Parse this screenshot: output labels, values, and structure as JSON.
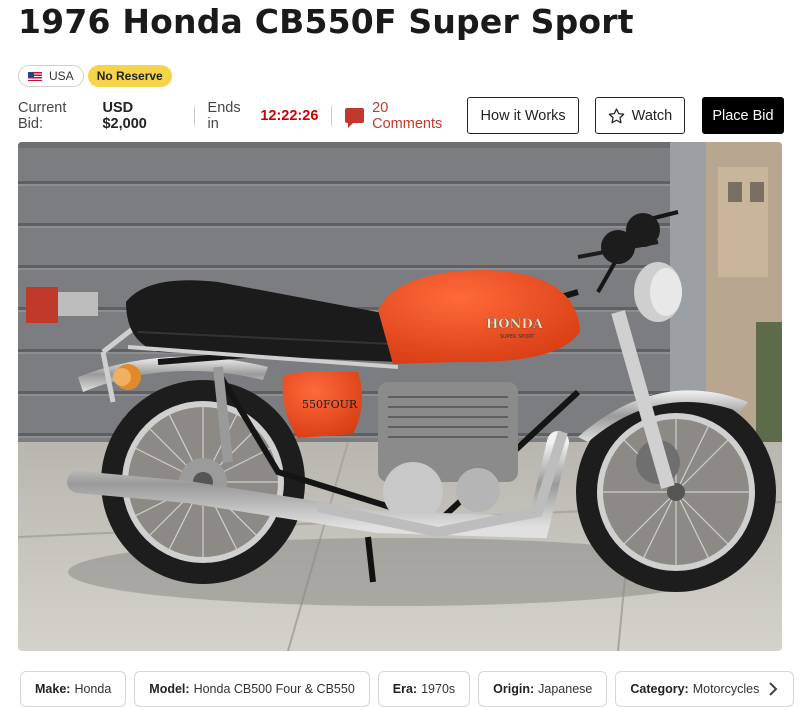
{
  "listing": {
    "title": "1976 Honda CB550F Super Sport",
    "country": "USA",
    "reserve": "No Reserve"
  },
  "bid": {
    "current_label": "Current Bid:",
    "current_value": "USD $2,000",
    "ends_label": "Ends in",
    "time_left": "12:22:26",
    "comments": "20 Comments"
  },
  "buttons": {
    "how": "How it Works",
    "watch": "Watch",
    "bid": "Place Bid"
  },
  "photo": {
    "tank_brand": "HONDA",
    "tank_sub": "SUPER SPORT",
    "side_cover": "550FOUR"
  },
  "details": [
    {
      "key": "Make:",
      "value": "Honda"
    },
    {
      "key": "Model:",
      "value": "Honda CB500 Four & CB550"
    },
    {
      "key": "Era:",
      "value": "1970s"
    },
    {
      "key": "Origin:",
      "value": "Japanese"
    },
    {
      "key": "Category:",
      "value": "Motorcycles"
    }
  ],
  "colors": {
    "timer": "#cc0000",
    "comments": "#c0392b",
    "reserve_badge": "#f6d44a",
    "tank": "#f04a20"
  },
  "icons": [
    "us-flag-icon",
    "comment-icon",
    "star-icon",
    "chevron-right-icon"
  ]
}
